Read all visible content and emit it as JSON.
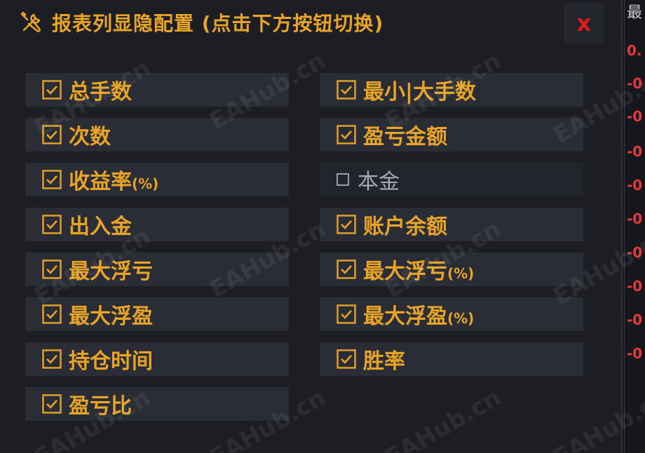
{
  "dialog": {
    "title": "报表列显隐配置 (点击下方按钮切换)",
    "title_icon": "wrench-screwdriver-icon",
    "close_label": "x"
  },
  "columns_left": [
    {
      "label": "总手数",
      "checked": true
    },
    {
      "label": "次数",
      "checked": true
    },
    {
      "label": "收益率",
      "suffix": "(%)",
      "checked": true
    },
    {
      "label": "出入金",
      "checked": true
    },
    {
      "label": "最大浮亏",
      "checked": true
    },
    {
      "label": "最大浮盈",
      "checked": true
    },
    {
      "label": "持仓时间",
      "checked": true
    },
    {
      "label": "盈亏比",
      "checked": true
    }
  ],
  "columns_right": [
    {
      "label": "最小|大手数",
      "checked": true
    },
    {
      "label": "盈亏金额",
      "checked": true
    },
    {
      "label": "本金",
      "checked": false
    },
    {
      "label": "账户余额",
      "checked": true
    },
    {
      "label": "最大浮亏",
      "suffix": "(%)",
      "checked": true
    },
    {
      "label": "最大浮盈",
      "suffix": "(%)",
      "checked": true
    },
    {
      "label": "胜率",
      "checked": true
    }
  ],
  "background_strip": {
    "header": "最",
    "values": [
      "0.",
      "-0",
      "-0",
      "-0",
      "-0",
      "-0",
      "-0",
      "-0",
      "-0",
      "-0"
    ]
  },
  "watermark": "EAHub.cn",
  "colors": {
    "accent": "#e8a426",
    "close": "#e11b1b",
    "panel": "#1c1e24",
    "item": "#2a2d35",
    "negative": "#e23a3a"
  }
}
